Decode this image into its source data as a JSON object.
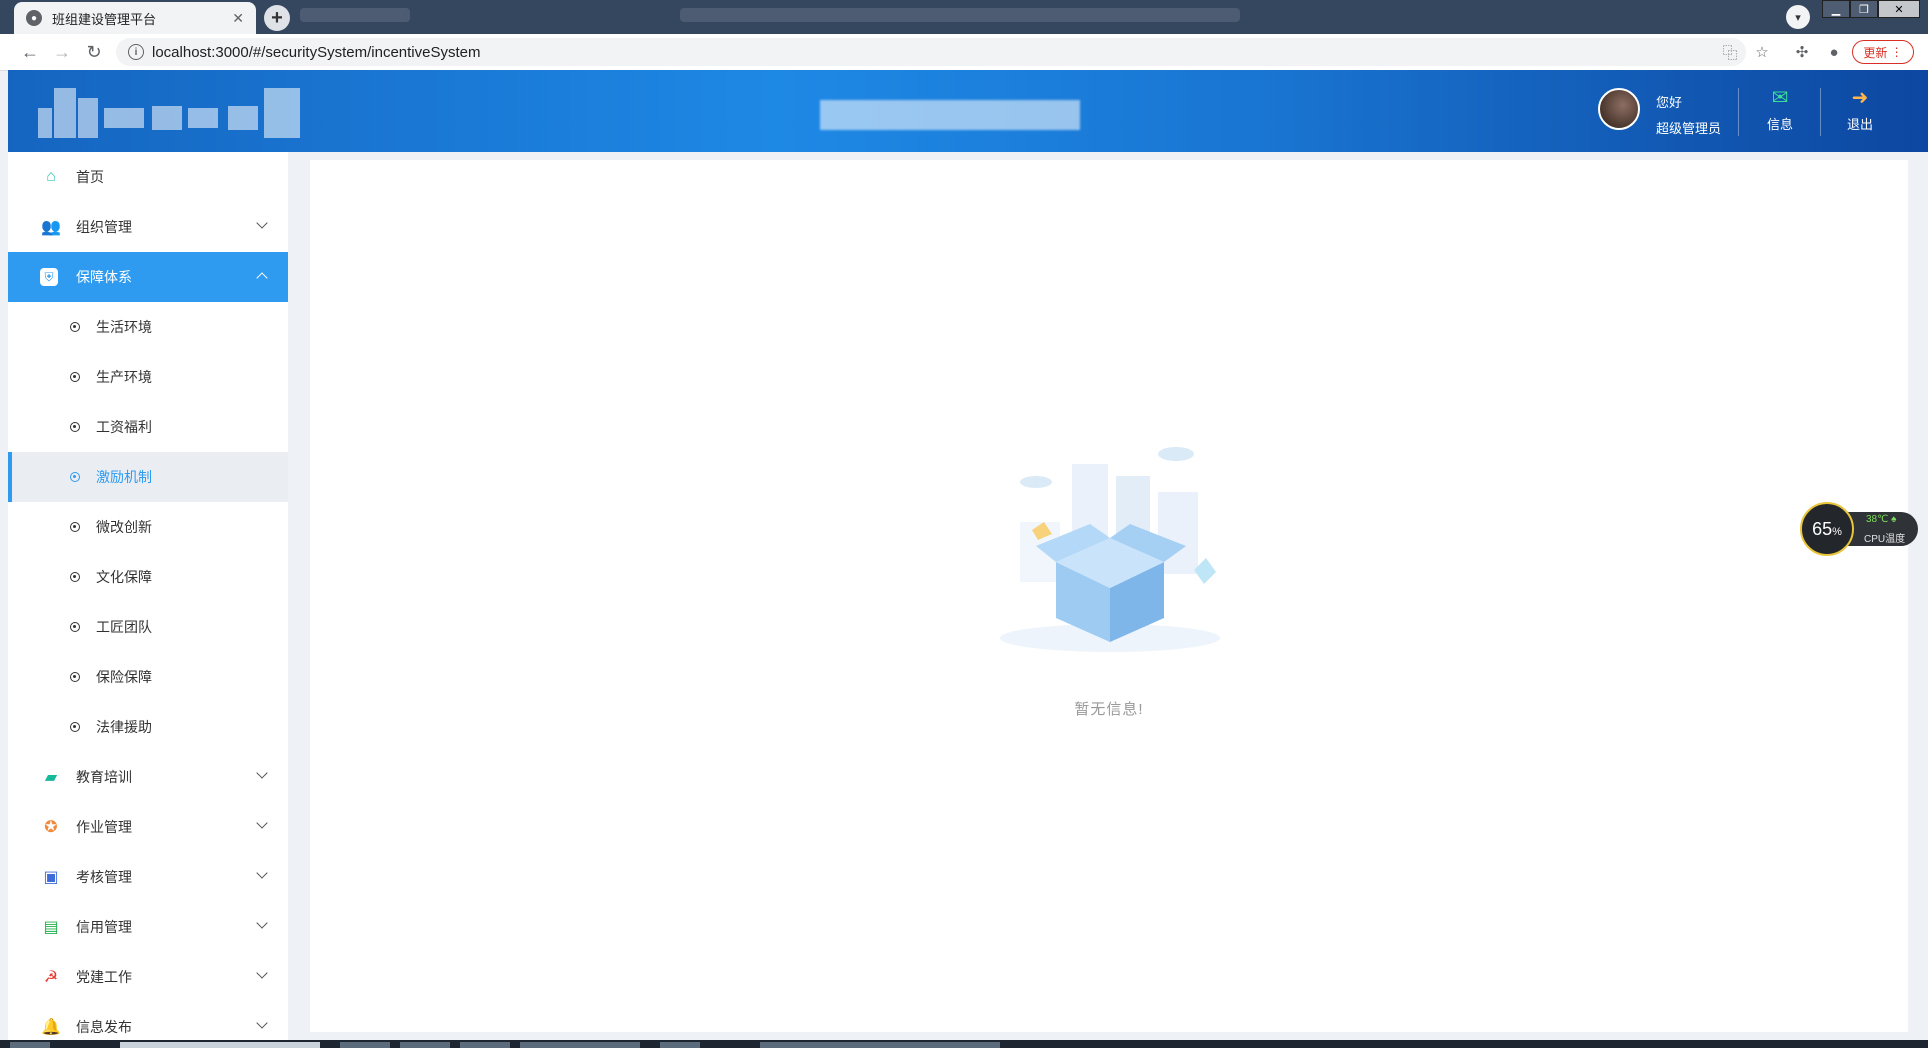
{
  "browser": {
    "tab_title": "班组建设管理平台",
    "url": "localhost:3000/#/securitySystem/incentiveSystem",
    "update_label": "更新"
  },
  "header": {
    "greeting": "您好",
    "username": "超级管理员",
    "messages_label": "信息",
    "logout_label": "退出"
  },
  "sidebar": {
    "items": [
      {
        "label": "首页",
        "icon": "home-icon",
        "color": "#35c5b5"
      },
      {
        "label": "组织管理",
        "icon": "users-icon",
        "color": "#2e7be8"
      },
      {
        "label": "保障体系",
        "icon": "shield-icon",
        "color": "#ffffff"
      },
      {
        "label": "教育培训",
        "icon": "training-icon",
        "color": "#18b99a"
      },
      {
        "label": "作业管理",
        "icon": "task-icon",
        "color": "#f08a3c"
      },
      {
        "label": "考核管理",
        "icon": "assessment-icon",
        "color": "#3f6bd8"
      },
      {
        "label": "信用管理",
        "icon": "credit-card-icon",
        "color": "#22b14c"
      },
      {
        "label": "党建工作",
        "icon": "party-icon",
        "color": "#e53935"
      },
      {
        "label": "信息发布",
        "icon": "bell-icon",
        "color": "#2e9bf0"
      }
    ],
    "submenu": [
      {
        "label": "生活环境"
      },
      {
        "label": "生产环境"
      },
      {
        "label": "工资福利"
      },
      {
        "label": "激励机制"
      },
      {
        "label": "微改创新"
      },
      {
        "label": "文化保障"
      },
      {
        "label": "工匠团队"
      },
      {
        "label": "保险保障"
      },
      {
        "label": "法律援助"
      }
    ]
  },
  "main": {
    "empty_text": "暂无信息!"
  },
  "cpu_widget": {
    "percent": "65",
    "percent_unit": "%",
    "temperature": "38℃",
    "label": "CPU温度"
  }
}
